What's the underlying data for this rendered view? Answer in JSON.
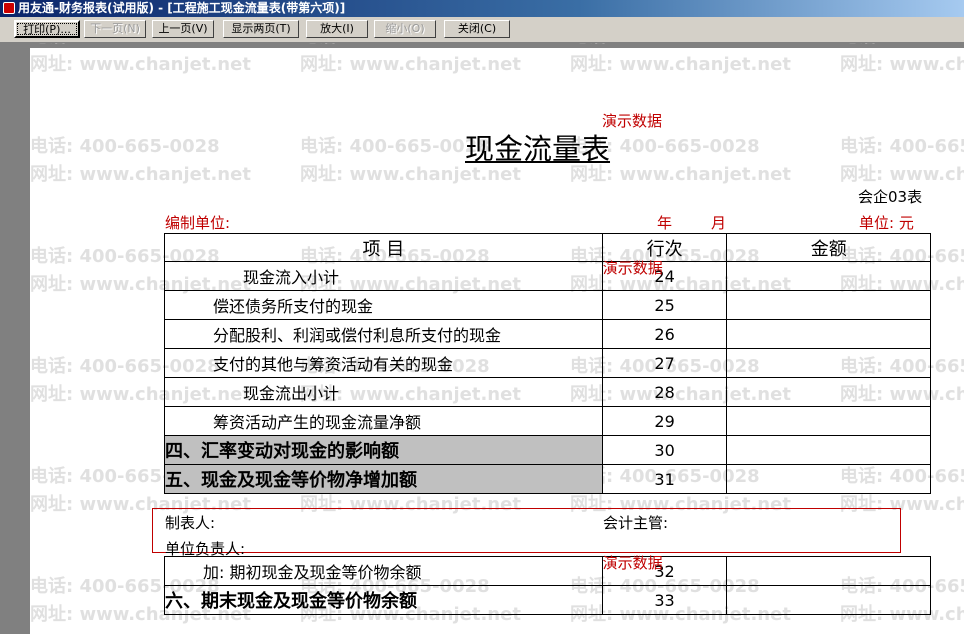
{
  "window": {
    "title": "用友通-财务报表(试用版) - [工程施工现金流量表(带第六项)]"
  },
  "toolbar": {
    "print": "打印(P)...",
    "next_page": "下一页(N)",
    "prev_page": "上一页(V)",
    "two_pages": "显示两页(T)",
    "zoom_in": "放大(I)",
    "zoom_out": "缩小(O)",
    "close": "关闭(C)"
  },
  "watermark": {
    "phone": "电话: 400-665-0028",
    "site": "网址: www.chanjet.net"
  },
  "demo_label": "演示数据",
  "report": {
    "title": "现金流量表",
    "form_code": "会企03表",
    "unit_label": "编制单位:",
    "year_label": "年",
    "month_label": "月",
    "currency_label": "单位: 元",
    "header": {
      "item": "项    目",
      "row": "行次",
      "amount": "金额"
    },
    "rows": [
      {
        "item": "现金流入小计",
        "row": "24",
        "amount": ""
      },
      {
        "item": "偿还债务所支付的现金",
        "row": "25",
        "amount": ""
      },
      {
        "item": "分配股利、利润或偿付利息所支付的现金",
        "row": "26",
        "amount": ""
      },
      {
        "item": "支付的其他与筹资活动有关的现金",
        "row": "27",
        "amount": ""
      },
      {
        "item": "现金流出小计",
        "row": "28",
        "amount": ""
      },
      {
        "item": "筹资活动产生的现金流量净额",
        "row": "29",
        "amount": ""
      },
      {
        "item": "四、汇率变动对现金的影响额",
        "row": "30",
        "amount": ""
      },
      {
        "item": "五、现金及现金等价物净增加额",
        "row": "31",
        "amount": ""
      }
    ],
    "signatures": {
      "preparer": "制表人:",
      "chief_accountant": "会计主管:",
      "unit_head": "单位负责人:"
    },
    "rows2": [
      {
        "item": "加: 期初现金及现金等价物余额",
        "row": "32",
        "amount": ""
      },
      {
        "item": "六、期末现金及现金等价物余额",
        "row": "33",
        "amount": ""
      }
    ]
  }
}
